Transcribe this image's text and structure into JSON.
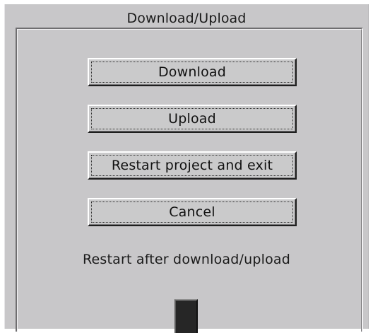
{
  "dialog": {
    "title": "Download/Upload",
    "buttons": {
      "download": "Download",
      "upload": "Upload",
      "restart": "Restart project and exit",
      "cancel": "Cancel"
    },
    "note": "Restart after download/upload"
  },
  "colors": {
    "background": "#c8c7c9",
    "button_face": "#cacacb",
    "text": "#111111"
  }
}
